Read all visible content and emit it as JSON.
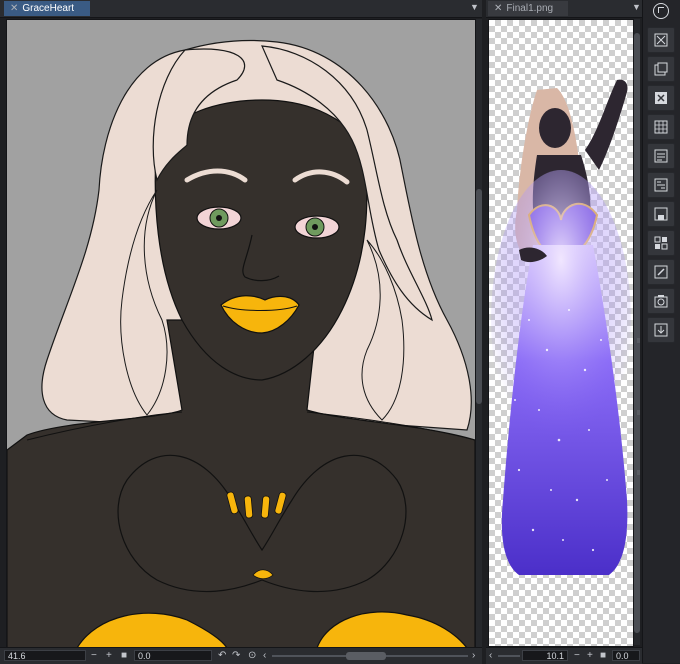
{
  "left_panel": {
    "tab_label": "GraceHeart",
    "zoom_value": "41.6",
    "rotation_value": "0.0"
  },
  "right_panel": {
    "tab_label": "Final1.png",
    "zoom_value": "10.1",
    "rotation_value": "0.0"
  },
  "toolbar_icons": [
    "navigator-icon",
    "layer-clear-icon",
    "copy-layer-icon",
    "delete-layer-icon",
    "grid-icon",
    "layer-list-icon",
    "reference-icon",
    "save-icon",
    "selection-icon",
    "edit-icon",
    "camera-icon",
    "export-icon"
  ],
  "colors": {
    "active_tab": "#3a5b84",
    "canvas_background": "#a1a1a1",
    "skin": "#35302c",
    "hair": "#ecdcd3",
    "lips_nails": "#f7b50c",
    "eyes": "#6f9a5e",
    "gown_glow": "#7d5cf3"
  }
}
